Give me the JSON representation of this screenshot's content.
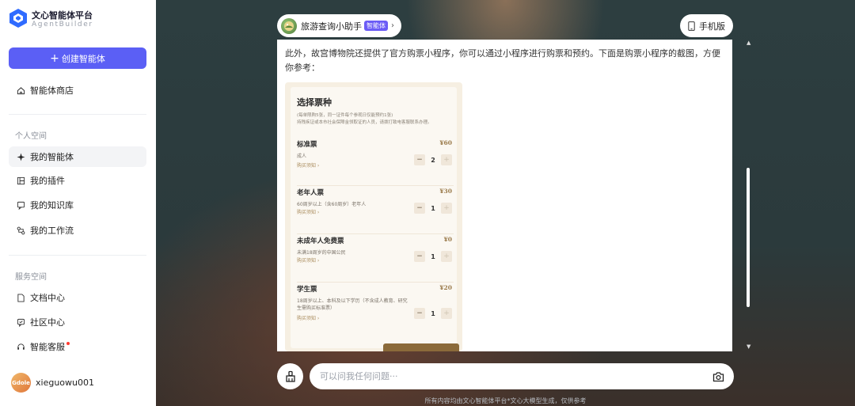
{
  "sidebar": {
    "brand_title": "文心智能体平台",
    "brand_subtitle": "AgentBuilder",
    "create_button": "创建智能体",
    "store_item": "智能体商店",
    "personal_section": "个人空间",
    "personal_items": [
      {
        "label": "我的智能体",
        "icon": "sparkle-icon"
      },
      {
        "label": "我的插件",
        "icon": "plugin-icon"
      },
      {
        "label": "我的知识库",
        "icon": "knowledge-icon"
      },
      {
        "label": "我的工作流",
        "icon": "workflow-icon"
      }
    ],
    "service_section": "服务空间",
    "service_items": [
      {
        "label": "文档中心",
        "icon": "document-icon"
      },
      {
        "label": "社区中心",
        "icon": "community-icon"
      },
      {
        "label": "智能客服",
        "icon": "headset-icon"
      }
    ],
    "username": "xieguowu001",
    "avatar_text": "Gdole"
  },
  "header": {
    "agent_name": "旅游查询小助手",
    "agent_badge": "智能体",
    "mobile_label": "手机版"
  },
  "chat": {
    "message": "此外，故宫博物院还提供了官方购票小程序，你可以通过小程序进行购票和预约。下面是购票小程序的截图，方便你参考："
  },
  "ticket_screen": {
    "title": "选择票种",
    "note": "(每单限购5张，同一证件每个参观日仅能预约1张)\n持残疾证或本市社会保障金领取证的人员，请拨打致电客服联系办理。",
    "link_text": "购买须知 ›",
    "tickets": [
      {
        "name": "标准票",
        "price": "¥60",
        "desc": "成人",
        "qty": "2"
      },
      {
        "name": "老年人票",
        "price": "¥30",
        "desc": "60周岁以上（含60周岁）老年人",
        "qty": "1"
      },
      {
        "name": "未成年人免费票",
        "price": "¥0",
        "desc": "未满18周岁的中国公民",
        "qty": "1"
      },
      {
        "name": "学生票",
        "price": "¥20",
        "desc": "18周岁以上、本科及以下学历（不含成人教育、研究生需购买标准票）",
        "qty": "1"
      }
    ]
  },
  "input": {
    "placeholder": "可以问我任何问题···"
  },
  "footer": "所有内容均由文心智能体平台*文心大模型生成，仅供参考",
  "colors": {
    "accent": "#5b5ff5",
    "badge": "#6b5cf6",
    "background": "#2a3b3e",
    "ticket_price": "#9a7a4a"
  }
}
